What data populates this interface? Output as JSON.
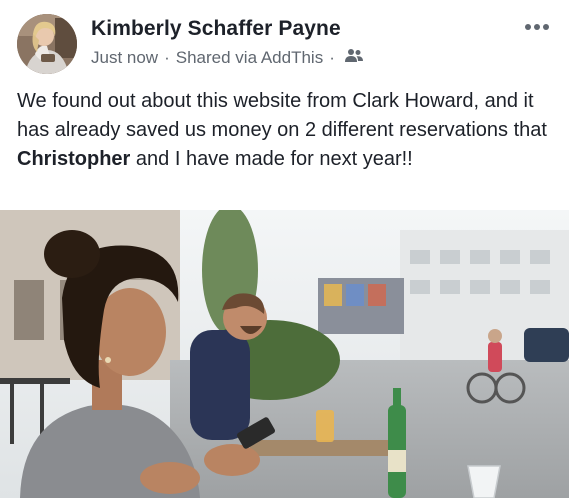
{
  "post": {
    "author_name": "Kimberly Schaffer Payne",
    "timestamp": "Just now",
    "separator": "·",
    "shared_via": "Shared via AddThis",
    "audience_icon": "friends-icon",
    "more_icon": "more-options-icon",
    "text_before": "We found out about this website from Clark Howard, and it has already saved us money on 2 different reservations that ",
    "text_bold": "Christopher",
    "text_after": " and I have made for next year!!",
    "photo": "woman-on-phone-at-outdoor-cafe"
  }
}
